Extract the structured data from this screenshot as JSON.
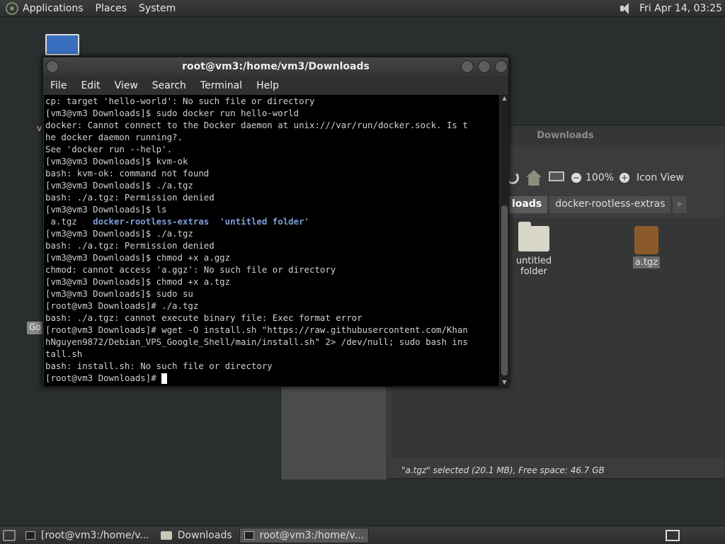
{
  "top_panel": {
    "menus": [
      "Applications",
      "Places",
      "System"
    ],
    "clock": "Fri Apr 14, 03:25"
  },
  "desktop": {
    "badge": "Go",
    "side_text": "v"
  },
  "file_manager": {
    "title": "Downloads",
    "zoom": "100%",
    "zoom_out": "−",
    "zoom_in": "+",
    "view_mode": "Icon View",
    "breadcrumbs": [
      "loads",
      "docker-rootless-extras"
    ],
    "items": [
      {
        "name": "untitled folder",
        "type": "folder"
      },
      {
        "name": "a.tgz",
        "type": "archive"
      }
    ],
    "status": "\"a.tgz\" selected (20.1 MB), Free space: 46.7 GB"
  },
  "terminal": {
    "title": "root@vm3:/home/vm3/Downloads",
    "menu": [
      "File",
      "Edit",
      "View",
      "Search",
      "Terminal",
      "Help"
    ],
    "lines": [
      "cp: target 'hello-world': No such file or directory",
      "[vm3@vm3 Downloads]$ sudo docker run hello-world",
      "docker: Cannot connect to the Docker daemon at unix:///var/run/docker.sock. Is t",
      "he docker daemon running?.",
      "See 'docker run --help'.",
      "[vm3@vm3 Downloads]$ kvm-ok",
      "bash: kvm-ok: command not found",
      "[vm3@vm3 Downloads]$ ./a.tgz",
      "bash: ./a.tgz: Permission denied",
      "[vm3@vm3 Downloads]$ ls",
      "__LS__",
      "[vm3@vm3 Downloads]$ ./a.tgz",
      "bash: ./a.tgz: Permission denied",
      "[vm3@vm3 Downloads]$ chmod +x a.ggz",
      "chmod: cannot access 'a.ggz': No such file or directory",
      "[vm3@vm3 Downloads]$ chmod +x a.tgz",
      "[vm3@vm3 Downloads]$ sudo su",
      "[root@vm3 Downloads]# ./a.tgz",
      "bash: ./a.tgz: cannot execute binary file: Exec format error",
      "[root@vm3 Downloads]# wget -O install.sh \"https://raw.githubusercontent.com/Khan",
      "hNguyen9872/Debian_VPS_Google_Shell/main/install.sh\" 2> /dev/null; sudo bash ins",
      "tall.sh",
      "bash: install.sh: No such file or directory",
      "__PROMPT__"
    ],
    "ls_output": {
      "file": " a.tgz",
      "dir1": "docker-rootless-extras",
      "dir2": "'untitled folder'"
    },
    "prompt": "[root@vm3 Downloads]# "
  },
  "taskbar": {
    "tasks": [
      {
        "label": "[root@vm3:/home/v...",
        "icon": "terminal-icon",
        "active": false
      },
      {
        "label": "Downloads",
        "icon": "folder-icon",
        "active": false
      },
      {
        "label": "root@vm3:/home/v...",
        "icon": "terminal-icon",
        "active": true
      }
    ]
  }
}
